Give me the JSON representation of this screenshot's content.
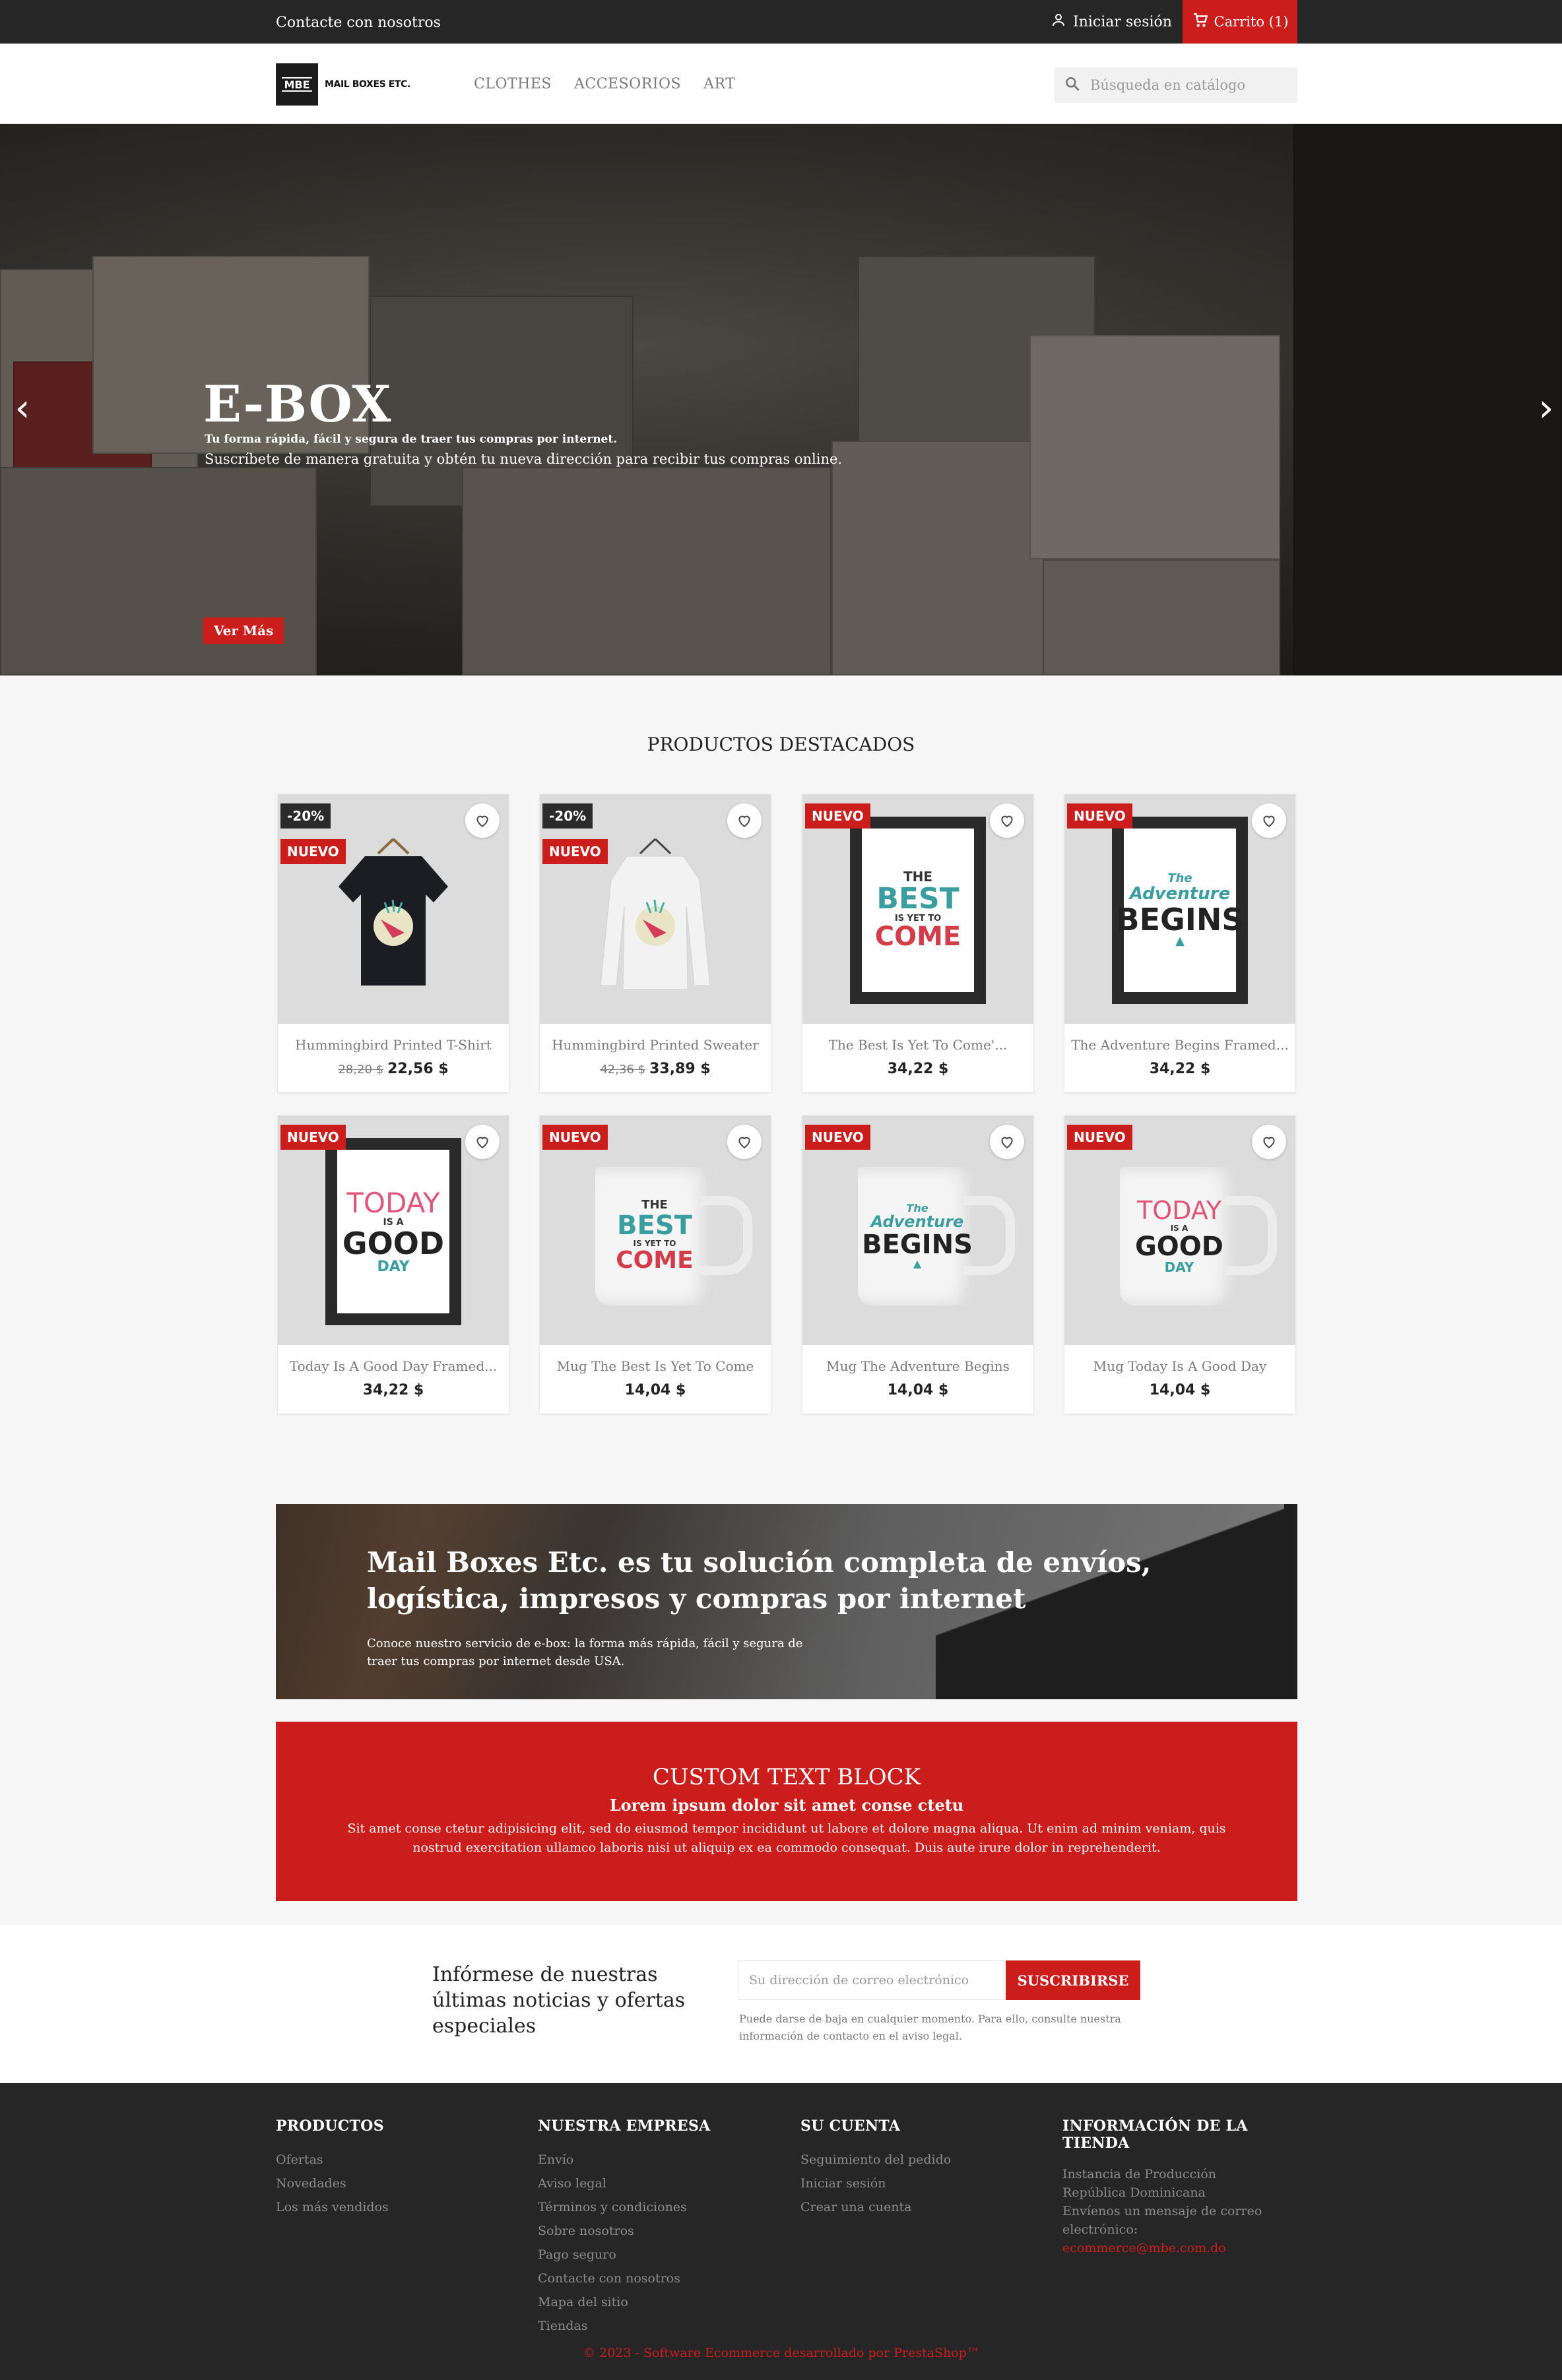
{
  "topbar": {
    "contact": "Contacte con nosotros",
    "login": "Iniciar sesión",
    "cart": "Carrito (1)"
  },
  "header": {
    "logo_mark": "MBE",
    "logo_text": "MAIL BOXES ETC.",
    "nav": [
      "CLOTHES",
      "ACCESORIOS",
      "ART"
    ],
    "search_placeholder": "Búsqueda en catálogo"
  },
  "hero": {
    "title": "E-BOX",
    "subtitle": "Tu forma rápida, fácil y segura de traer tus compras por internet.",
    "description": "Suscríbete de manera gratuita y obtén tu nueva dirección para recibir tus compras online.",
    "button": "Ver Más"
  },
  "featured": {
    "title": "PRODUCTOS DESTACADOS",
    "products": [
      {
        "name": "Hummingbird Printed T-Shirt",
        "old_price": "28,20 $",
        "price": "22,56 $",
        "discount": "-20%",
        "flag": "NUEVO"
      },
      {
        "name": "Hummingbird Printed Sweater",
        "old_price": "42,36 $",
        "price": "33,89 $",
        "discount": "-20%",
        "flag": "NUEVO"
      },
      {
        "name": "The Best Is Yet To Come'...",
        "price": "34,22 $",
        "flag": "NUEVO"
      },
      {
        "name": "The Adventure Begins Framed...",
        "price": "34,22 $",
        "flag": "NUEVO"
      },
      {
        "name": "Today Is A Good Day Framed...",
        "price": "34,22 $",
        "flag": "NUEVO"
      },
      {
        "name": "Mug The Best Is Yet To Come",
        "price": "14,04 $",
        "flag": "NUEVO"
      },
      {
        "name": "Mug The Adventure Begins",
        "price": "14,04 $",
        "flag": "NUEVO"
      },
      {
        "name": "Mug Today Is A Good Day",
        "price": "14,04 $",
        "flag": "NUEVO"
      }
    ]
  },
  "banner": {
    "title": "Mail Boxes Etc. es tu solución completa de envíos, logística, impresos y compras por internet",
    "text": "Conoce nuestro servicio de e-box: la forma más rápida, fácil y segura de traer tus compras por internet desde USA."
  },
  "custom_block": {
    "title": "CUSTOM TEXT BLOCK",
    "subtitle": "Lorem ipsum dolor sit amet conse ctetu",
    "text": "Sit amet conse ctetur adipisicing elit, sed do eiusmod tempor incididunt ut labore et dolore magna aliqua. Ut enim ad minim veniam, quis nostrud exercitation ullamco laboris nisi ut aliquip ex ea commodo consequat. Duis aute irure dolor in reprehenderit."
  },
  "newsletter": {
    "label": "Infórmese de nuestras últimas noticias y ofertas especiales",
    "placeholder": "Su dirección de correo electrónico",
    "button": "SUSCRIBIRSE",
    "note": "Puede darse de baja en cualquier momento. Para ello, consulte nuestra información de contacto en el aviso legal."
  },
  "footer": {
    "products": {
      "title": "PRODUCTOS",
      "links": [
        "Ofertas",
        "Novedades",
        "Los más vendidos"
      ]
    },
    "company": {
      "title": "NUESTRA EMPRESA",
      "links": [
        "Envío",
        "Aviso legal",
        "Términos y condiciones",
        "Sobre nosotros",
        "Pago seguro",
        "Contacte con nosotros",
        "Mapa del sitio",
        "Tiendas"
      ]
    },
    "account": {
      "title": "SU CUENTA",
      "links": [
        "Seguimiento del pedido",
        "Iniciar sesión",
        "Crear una cuenta"
      ]
    },
    "store": {
      "title": "INFORMACIÓN DE LA TIENDA",
      "lines": [
        "Instancia de Producción",
        "República Dominicana",
        "Envíenos un mensaje de correo electrónico:"
      ],
      "email": "ecommerce@mbe.com.do"
    },
    "copyright": "© 2023 - Software Ecommerce desarrollado por PrestaShop™"
  },
  "colors": {
    "accent": "#cc1d1d",
    "dark": "#262626"
  }
}
